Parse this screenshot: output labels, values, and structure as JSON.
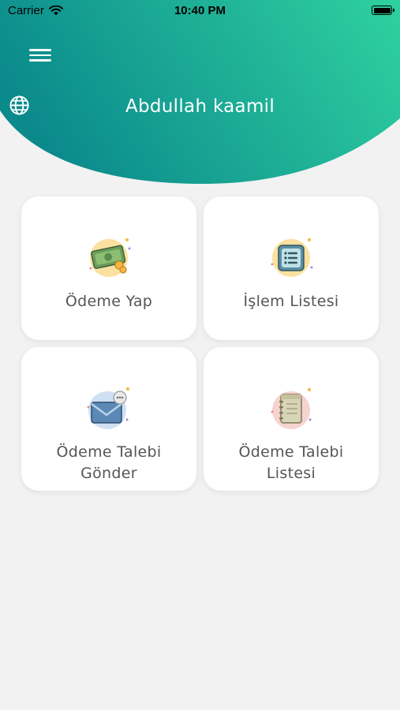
{
  "status_bar": {
    "carrier": "Carrier",
    "time": "10:40 PM"
  },
  "header": {
    "user_name": "Abdullah kaamil",
    "gradient_start": "#0b8a8c",
    "gradient_end": "#2ecf9f"
  },
  "menu": [
    {
      "label": "Ödeme Yap",
      "icon": "money-icon"
    },
    {
      "label": "İşlem Listesi",
      "icon": "list-icon"
    },
    {
      "label": "Ödeme Talebi Gönder",
      "icon": "envelope-icon"
    },
    {
      "label": "Ödeme Talebi Listesi",
      "icon": "notebook-icon"
    }
  ]
}
